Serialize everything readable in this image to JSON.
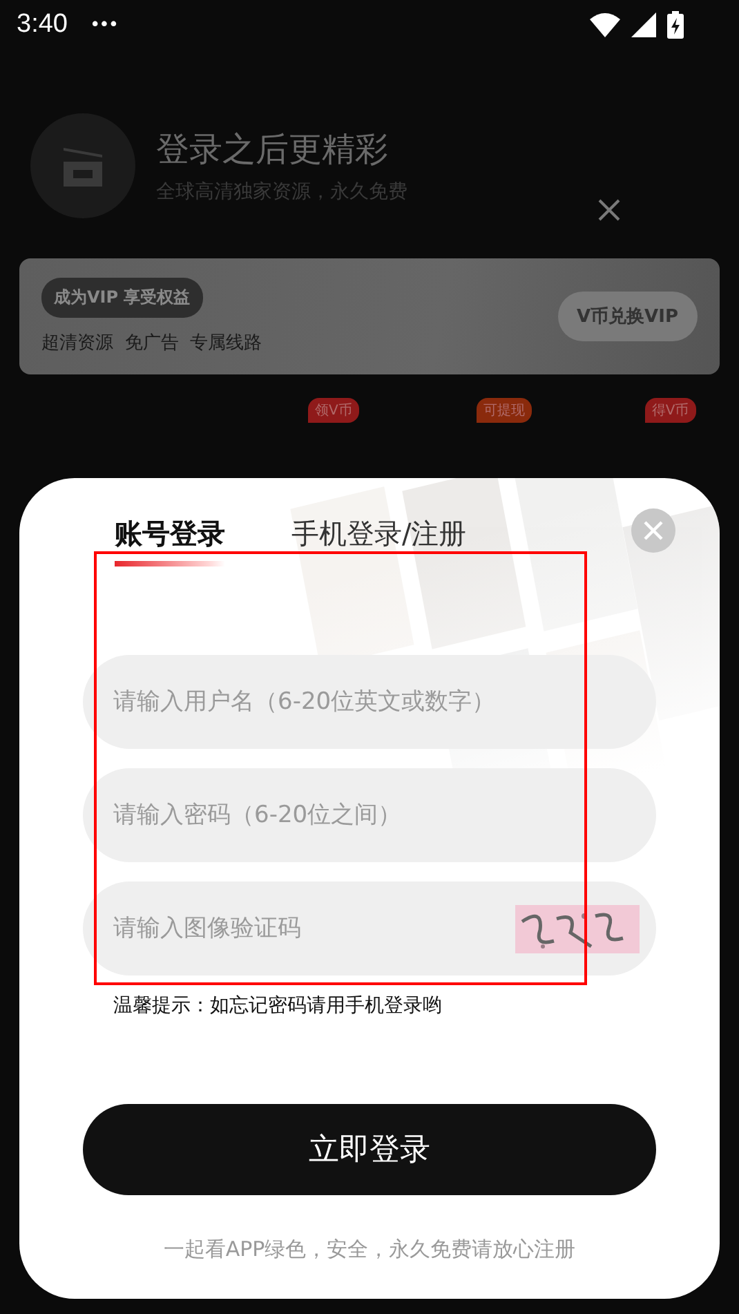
{
  "status_bar": {
    "time": "3:40",
    "more": "•••"
  },
  "header": {
    "title": "登录之后更精彩",
    "subtitle": "全球高清独家资源，永久免费"
  },
  "vip_card": {
    "badge": "成为VIP 享受权益",
    "perks": "超清资源  免广告  专属线路",
    "button": "V币兑换VIP"
  },
  "tags": [
    {
      "label": "领V币",
      "color": "#8f1a1a"
    },
    {
      "label": "可提现",
      "color": "#8a2a0c"
    },
    {
      "label": "得V币",
      "color": "#8f1a1a"
    }
  ],
  "login_dialog": {
    "tabs": [
      {
        "label": "账号登录",
        "selected": true
      },
      {
        "label": "手机登录/注册",
        "selected": false
      }
    ],
    "fields": [
      {
        "placeholder": "请输入用户名（6-20位英文或数字）",
        "kind": "text"
      },
      {
        "placeholder": "请输入密码（6-20位之间）",
        "kind": "password"
      },
      {
        "placeholder": "请输入图像验证码",
        "kind": "captcha"
      }
    ],
    "hint": "温馨提示：如忘记密码请用手机登录哟",
    "login_button": "立即登录",
    "footer": "一起看APP绿色，安全，永久免费请放心注册"
  }
}
